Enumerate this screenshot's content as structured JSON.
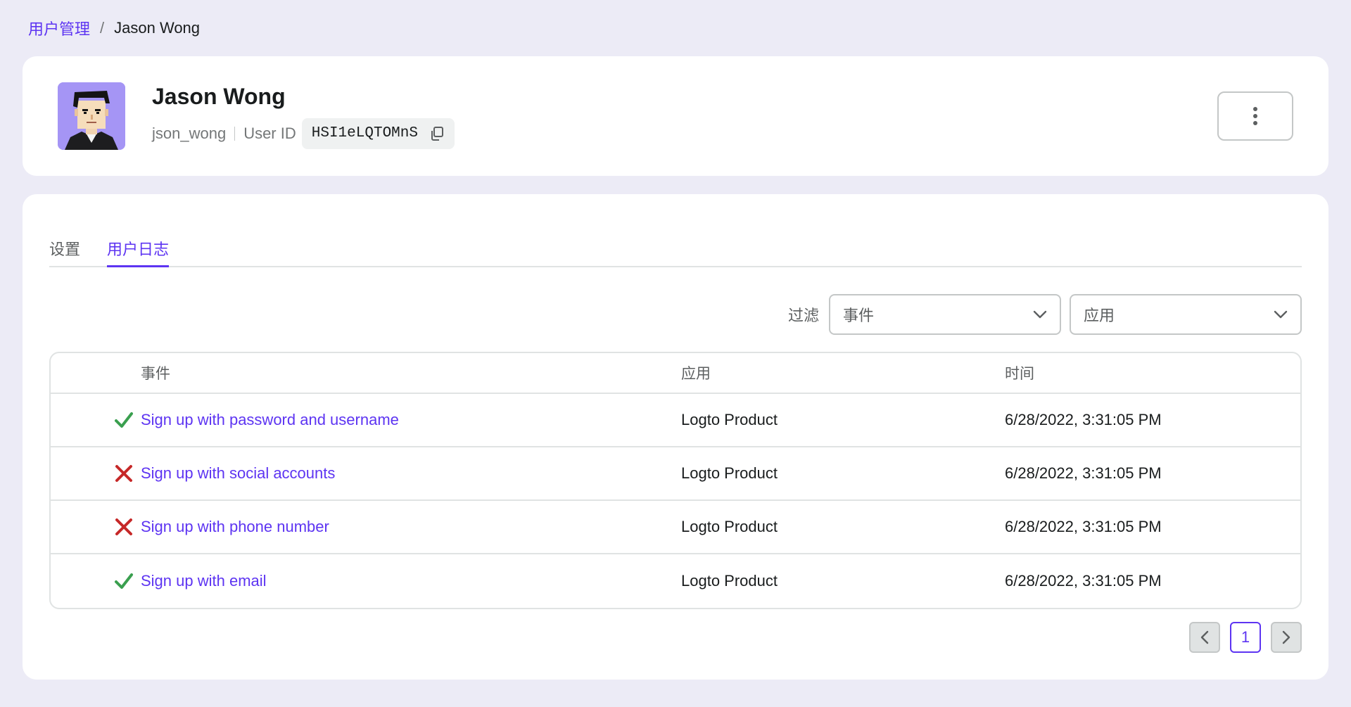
{
  "breadcrumb": {
    "parent": "用户管理",
    "separator": "/",
    "current": "Jason Wong"
  },
  "user": {
    "name": "Jason Wong",
    "username": "json_wong",
    "id_label": "User ID",
    "id_value": "HSI1eLQTOMnS"
  },
  "tabs": [
    {
      "label": "设置",
      "active": false
    },
    {
      "label": "用户日志",
      "active": true
    }
  ],
  "filter": {
    "label": "过滤",
    "event_select": "事件",
    "app_select": "应用"
  },
  "table": {
    "columns": [
      "事件",
      "应用",
      "时间"
    ],
    "rows": [
      {
        "status": "success",
        "event": "Sign up with password and username",
        "app": "Logto Product",
        "time": "6/28/2022, 3:31:05 PM"
      },
      {
        "status": "failure",
        "event": "Sign up with social accounts",
        "app": "Logto Product",
        "time": "6/28/2022, 3:31:05 PM"
      },
      {
        "status": "failure",
        "event": "Sign up with phone number",
        "app": "Logto Product",
        "time": "6/28/2022, 3:31:05 PM"
      },
      {
        "status": "success",
        "event": "Sign up with email",
        "app": "Logto Product",
        "time": "6/28/2022, 3:31:05 PM"
      }
    ]
  },
  "pagination": {
    "current_page": "1"
  },
  "colors": {
    "primary": "#5d34f2",
    "success": "#3a9f4f",
    "error": "#c62828",
    "background": "#ecebf6"
  },
  "icons": {
    "copy": "copy-icon",
    "more": "more-vertical-icon",
    "chevron": "chevron-down-icon",
    "success": "checkmark-icon",
    "failure": "cross-icon",
    "prev": "chevron-left-icon",
    "next": "chevron-right-icon"
  }
}
